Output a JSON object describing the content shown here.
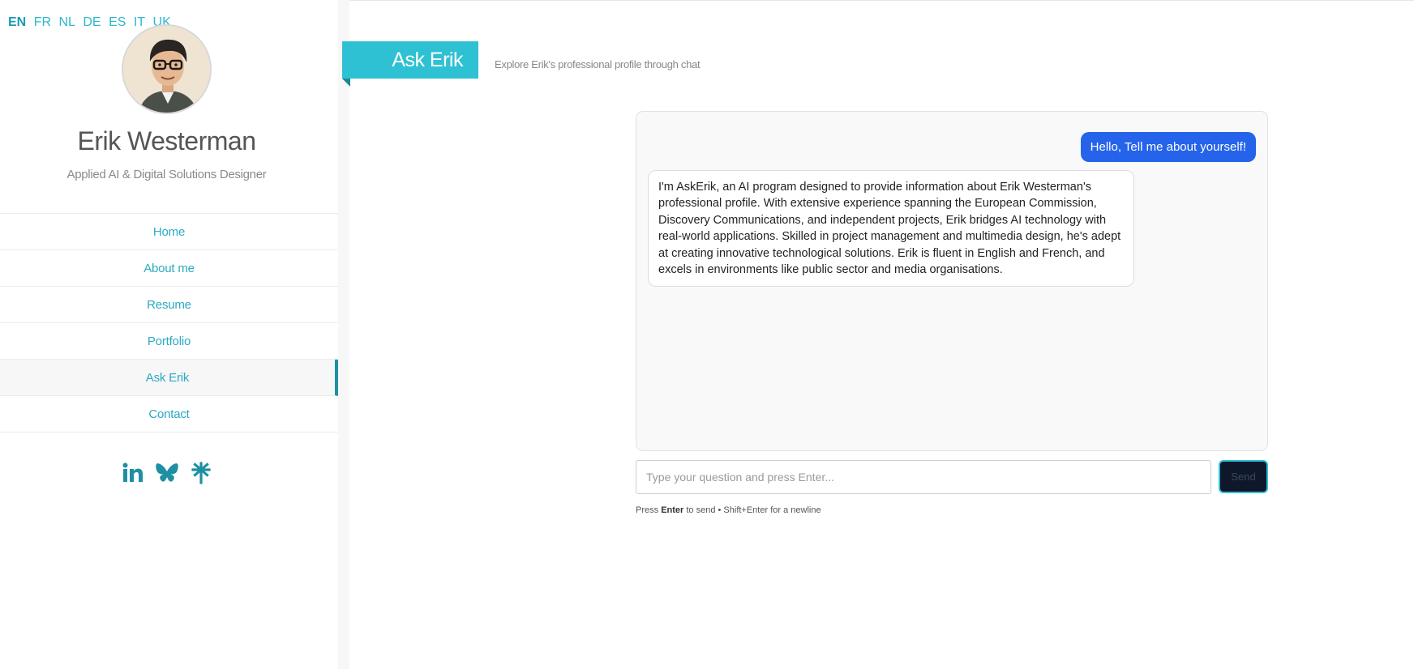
{
  "languages": [
    {
      "code": "EN",
      "active": true
    },
    {
      "code": "FR",
      "active": false
    },
    {
      "code": "NL",
      "active": false
    },
    {
      "code": "DE",
      "active": false
    },
    {
      "code": "ES",
      "active": false
    },
    {
      "code": "IT",
      "active": false
    },
    {
      "code": "UK",
      "active": false
    }
  ],
  "profile": {
    "name": "Erik Westerman",
    "role": "Applied AI & Digital Solutions Designer"
  },
  "nav": {
    "items": [
      {
        "label": "Home"
      },
      {
        "label": "About me"
      },
      {
        "label": "Resume"
      },
      {
        "label": "Portfolio"
      },
      {
        "label": "Ask Erik",
        "active": true
      },
      {
        "label": "Contact"
      }
    ]
  },
  "social": {
    "icons": [
      "linkedin-icon",
      "bluesky-icon",
      "linktree-icon"
    ],
    "color": "#1f8fa3"
  },
  "header": {
    "tag": "Ask Erik",
    "subtitle": "Explore Erik's professional profile through chat"
  },
  "chat": {
    "messages": [
      {
        "role": "user",
        "text": "Hello, Tell me about yourself!"
      },
      {
        "role": "assistant",
        "text": "I'm AskErik, an AI program designed to provide information about Erik Westerman's professional profile. With extensive experience spanning the European Commission, Discovery Communications, and independent projects, Erik bridges AI technology with real-world applications. Skilled in project management and multimedia design, he's adept at creating innovative technological solutions. Erik is fluent in English and French, and excels in environments like public sector and media organisations."
      }
    ],
    "input_placeholder": "Type your question and press Enter...",
    "input_value": "",
    "send_label": "Send",
    "hint_prefix": "Press ",
    "hint_key": "Enter",
    "hint_suffix": " to send • Shift+Enter for a newline"
  },
  "colors": {
    "accent": "#2ec1d3",
    "user_bubble": "#2563eb",
    "nav_text": "#2aaac2"
  }
}
